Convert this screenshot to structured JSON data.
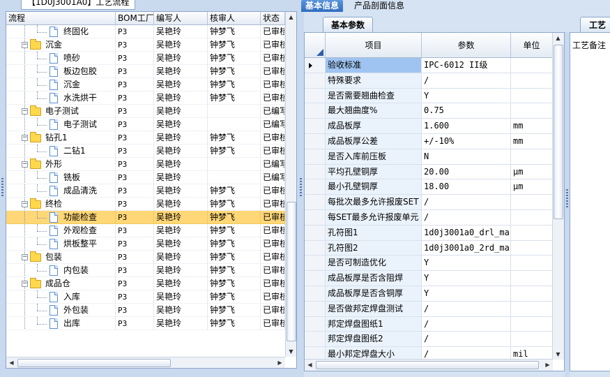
{
  "left_panel": {
    "tab_label": "【1D0J3001A0】工艺流程",
    "columns": [
      "流程",
      "BOM工厂",
      "编写人",
      "核审人",
      "状态"
    ],
    "rows": [
      {
        "label": "终固化",
        "level": 1,
        "kind": "doc",
        "bom": "P3",
        "writer": "吴艳玲",
        "auditor": "钟梦飞",
        "status": "已审核"
      },
      {
        "label": "沉金",
        "level": 0,
        "kind": "folder",
        "bom": "P3",
        "writer": "吴艳玲",
        "auditor": "钟梦飞",
        "status": "已审核"
      },
      {
        "label": "喷砂",
        "level": 1,
        "kind": "doc",
        "bom": "P3",
        "writer": "吴艳玲",
        "auditor": "钟梦飞",
        "status": "已审核"
      },
      {
        "label": "板边包胶",
        "level": 1,
        "kind": "doc",
        "bom": "P3",
        "writer": "吴艳玲",
        "auditor": "钟梦飞",
        "status": "已审核"
      },
      {
        "label": "沉金",
        "level": 1,
        "kind": "doc",
        "bom": "P3",
        "writer": "吴艳玲",
        "auditor": "钟梦飞",
        "status": "已审核"
      },
      {
        "label": "水洗烘干",
        "level": 1,
        "kind": "doc",
        "bom": "P3",
        "writer": "吴艳玲",
        "auditor": "钟梦飞",
        "status": "已审核"
      },
      {
        "label": "电子测试",
        "level": 0,
        "kind": "folder",
        "bom": "P3",
        "writer": "吴艳玲",
        "auditor": "",
        "status": "已编写"
      },
      {
        "label": "电子测试",
        "level": 1,
        "kind": "doc",
        "bom": "P3",
        "writer": "吴艳玲",
        "auditor": "",
        "status": "已编写"
      },
      {
        "label": "钻孔1",
        "level": 0,
        "kind": "folder",
        "bom": "P3",
        "writer": "吴艳玲",
        "auditor": "钟梦飞",
        "status": "已审核"
      },
      {
        "label": "二钻1",
        "level": 1,
        "kind": "doc",
        "bom": "P3",
        "writer": "吴艳玲",
        "auditor": "钟梦飞",
        "status": "已审核"
      },
      {
        "label": "外形",
        "level": 0,
        "kind": "folder",
        "bom": "P3",
        "writer": "吴艳玲",
        "auditor": "",
        "status": "已编写"
      },
      {
        "label": "铣板",
        "level": 1,
        "kind": "doc",
        "bom": "P3",
        "writer": "吴艳玲",
        "auditor": "",
        "status": "已编写"
      },
      {
        "label": "成品清洗",
        "level": 1,
        "kind": "doc",
        "bom": "P3",
        "writer": "吴艳玲",
        "auditor": "钟梦飞",
        "status": "已审核"
      },
      {
        "label": "终检",
        "level": 0,
        "kind": "folder",
        "bom": "P3",
        "writer": "吴艳玲",
        "auditor": "钟梦飞",
        "status": "已审核"
      },
      {
        "label": "功能检查",
        "level": 1,
        "kind": "doc",
        "bom": "P3",
        "writer": "吴艳玲",
        "auditor": "钟梦飞",
        "status": "已审核",
        "selected": true
      },
      {
        "label": "外观检查",
        "level": 1,
        "kind": "doc",
        "bom": "P3",
        "writer": "吴艳玲",
        "auditor": "钟梦飞",
        "status": "已审核"
      },
      {
        "label": "烘板整平",
        "level": 1,
        "kind": "doc",
        "bom": "P3",
        "writer": "吴艳玲",
        "auditor": "钟梦飞",
        "status": "已审核"
      },
      {
        "label": "包装",
        "level": 0,
        "kind": "folder",
        "bom": "P3",
        "writer": "吴艳玲",
        "auditor": "钟梦飞",
        "status": "已审核"
      },
      {
        "label": "内包装",
        "level": 1,
        "kind": "doc",
        "bom": "P3",
        "writer": "吴艳玲",
        "auditor": "钟梦飞",
        "status": "已审核"
      },
      {
        "label": "成品仓",
        "level": 0,
        "kind": "folder",
        "bom": "P3",
        "writer": "吴艳玲",
        "auditor": "钟梦飞",
        "status": "已审核"
      },
      {
        "label": "入库",
        "level": 1,
        "kind": "doc",
        "bom": "P3",
        "writer": "吴艳玲",
        "auditor": "钟梦飞",
        "status": "已审核"
      },
      {
        "label": "外包装",
        "level": 1,
        "kind": "doc",
        "bom": "P3",
        "writer": "吴艳玲",
        "auditor": "钟梦飞",
        "status": "已审核"
      },
      {
        "label": "出库",
        "level": 1,
        "kind": "doc",
        "bom": "P3",
        "writer": "吴艳玲",
        "auditor": "钟梦飞",
        "status": "已审核"
      }
    ]
  },
  "top_tabs": [
    "基本信息",
    "产品剖面信息"
  ],
  "sub_tab_params": "基本参数",
  "sub_tab_craft": "工艺",
  "params_grid": {
    "columns": [
      "项目",
      "参数",
      "单位"
    ],
    "rows": [
      {
        "item": "验收标准",
        "param": "IPC-6012 II级",
        "unit": "",
        "selected": true
      },
      {
        "item": "特殊要求",
        "param": "/",
        "unit": ""
      },
      {
        "item": "是否需要翘曲检查",
        "param": "Y",
        "unit": ""
      },
      {
        "item": "最大翘曲度%",
        "param": "0.75",
        "unit": ""
      },
      {
        "item": "成品板厚",
        "param": "1.600",
        "unit": "mm"
      },
      {
        "item": "成品板厚公差",
        "param": "+/-10%",
        "unit": "mm"
      },
      {
        "item": "是否入库前压板",
        "param": "N",
        "unit": ""
      },
      {
        "item": "平均孔壁铜厚",
        "param": "20.00",
        "unit": "μm"
      },
      {
        "item": "最小孔壁铜厚",
        "param": "18.00",
        "unit": "μm"
      },
      {
        "item": "每批次最多允许报废SET",
        "param": "/",
        "unit": ""
      },
      {
        "item": "每SET最多允许报废单元",
        "param": "/",
        "unit": ""
      },
      {
        "item": "孔符图1",
        "param": "1d0j3001a0_drl_ma...",
        "unit": ""
      },
      {
        "item": "孔符图2",
        "param": "1d0j3001a0_2rd_ma...",
        "unit": ""
      },
      {
        "item": "是否可制造优化",
        "param": "Y",
        "unit": ""
      },
      {
        "item": "成品板厚是否含阻焊",
        "param": "Y",
        "unit": ""
      },
      {
        "item": "成品板厚是否含铜厚",
        "param": "Y",
        "unit": ""
      },
      {
        "item": "是否做邦定焊盘测试",
        "param": "/",
        "unit": ""
      },
      {
        "item": "邦定焊盘图纸1",
        "param": "/",
        "unit": ""
      },
      {
        "item": "邦定焊盘图纸2",
        "param": "/",
        "unit": ""
      },
      {
        "item": "最小邦定焊盘大小",
        "param": "/",
        "unit": "mil"
      }
    ]
  },
  "right_panel": {
    "header": "工艺备注"
  }
}
